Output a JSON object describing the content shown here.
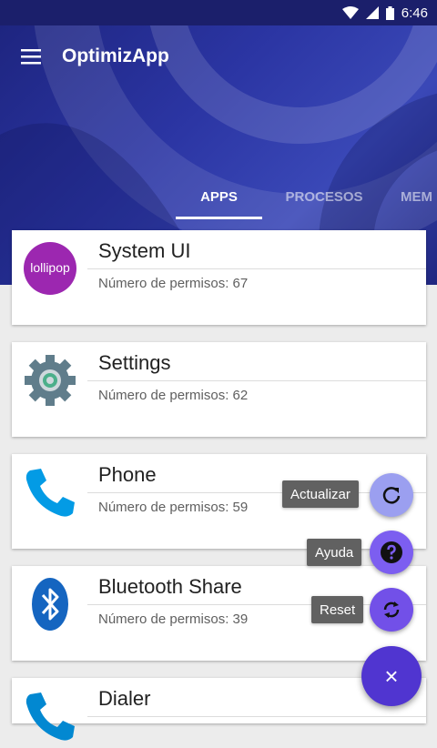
{
  "status": {
    "time": "6:46"
  },
  "app": {
    "title": "OptimizApp"
  },
  "tabs": [
    {
      "label": "APPS",
      "active": true
    },
    {
      "label": "PROCESOS",
      "active": false
    },
    {
      "label": "MEM",
      "active": false
    }
  ],
  "apps": [
    {
      "name": "System UI",
      "permissions": "Número de permisos: 67",
      "icon": "lollipop-icon",
      "icon_text": "lollipop"
    },
    {
      "name": "Settings",
      "permissions": "Número de permisos: 62",
      "icon": "settings-gear-icon"
    },
    {
      "name": "Phone",
      "permissions": "Número de permisos: 59",
      "icon": "phone-icon"
    },
    {
      "name": "Bluetooth Share",
      "permissions": "Número de permisos: 39",
      "icon": "bluetooth-icon"
    },
    {
      "name": "Dialer",
      "permissions": "",
      "icon": "dialer-icon"
    }
  ],
  "fab_menu": {
    "actions": [
      {
        "label": "Actualizar",
        "icon": "refresh-icon",
        "color": "#9b9ff0"
      },
      {
        "label": "Ayuda",
        "icon": "help-icon",
        "color": "#7c5ef0"
      },
      {
        "label": "Reset",
        "icon": "sync-icon",
        "color": "#7250e8"
      }
    ],
    "main_icon": "close-icon",
    "main_glyph": "×",
    "main_color": "#5035d0"
  },
  "colors": {
    "header": "#2b35a3",
    "accent": "#5035d0"
  }
}
